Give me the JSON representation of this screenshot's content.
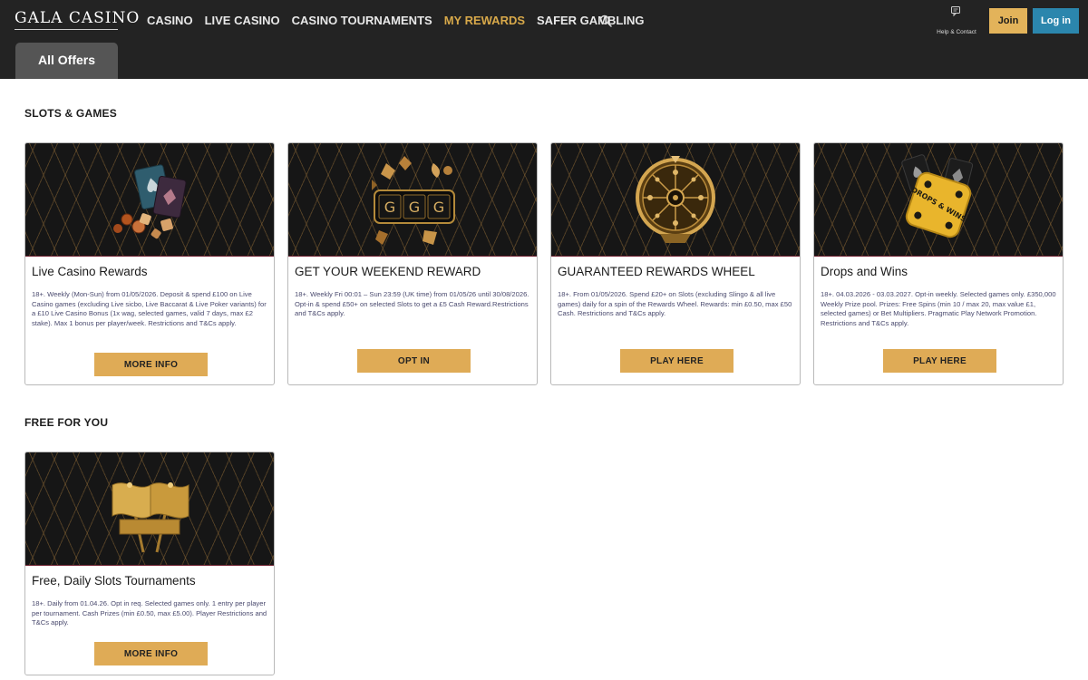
{
  "header": {
    "logo_text": "GALA CASINO",
    "nav": [
      "CASINO",
      "LIVE CASINO",
      "CASINO TOURNAMENTS",
      "MY REWARDS",
      "SAFER GAMBLING"
    ],
    "active_nav": "MY REWARDS",
    "help_label": "Help & Contact",
    "join_label": "Join",
    "login_label": "Log in",
    "tab_label": "All Offers"
  },
  "colors": {
    "header_bg": "#232323",
    "accent_gold": "#dfab56",
    "login_blue": "#2b86ad"
  },
  "sections": {
    "slots": {
      "title": "SLOTS & GAMES",
      "cards": [
        {
          "title": "Live Casino Rewards",
          "desc": "18+. Weekly (Mon-Sun) from 01/05/2026. Deposit & spend £100 on Live Casino games (excluding Live sicbo, Live Baccarat & Live Poker variants) for a £10 Live Casino Bonus (1x wag, selected games, valid 7 days, max £2 stake). Max 1 bonus per player/week. Restrictions and T&Cs apply.",
          "button": "MORE INFO",
          "image": "playing-cards-chips-icon"
        },
        {
          "title": "GET YOUR WEEKEND REWARD",
          "desc": "18+. Weekly Fri 00:01 – Sun 23:59 (UK time) from 01/05/26 until 30/08/2026. Opt-in & spend £50+ on selected Slots to get a £5 Cash Reward.Restrictions and T&Cs apply.",
          "button": "OPT IN",
          "image": "slot-reels-icon"
        },
        {
          "title": "GUARANTEED REWARDS WHEEL",
          "desc": "18+. From 01/05/2026. Spend £20+ on Slots (excluding Slingo & all live games) daily for a spin of the Rewards Wheel. Rewards: min £0.50, max £50 Cash. Restrictions and T&Cs apply.",
          "button": "PLAY HERE",
          "image": "rewards-wheel-icon"
        },
        {
          "title": "Drops and Wins",
          "desc": "18+. 04.03.2026 - 03.03.2027. Opt-in weekly. Selected games only. £350,000 Weekly Prize pool. Prizes: Free Spins (min 10 / max 20, max value £1, selected games) or Bet Multipliers. Pragmatic Play Network Promotion. Restrictions and T&Cs apply.",
          "button": "PLAY HERE",
          "image": "dice-icon",
          "image_text": "DROPS & WINS"
        }
      ]
    },
    "free": {
      "title": "FREE FOR YOU",
      "cards": [
        {
          "title": "Free, Daily Slots Tournaments",
          "desc": "18+. Daily from 01.04.26. Opt in req. Selected games only. 1 entry per player per tournament. Cash Prizes (min £0.50, max £5.00). Player Restrictions and T&Cs apply.",
          "button": "MORE INFO",
          "image": "gold-flags-icon"
        }
      ]
    }
  }
}
